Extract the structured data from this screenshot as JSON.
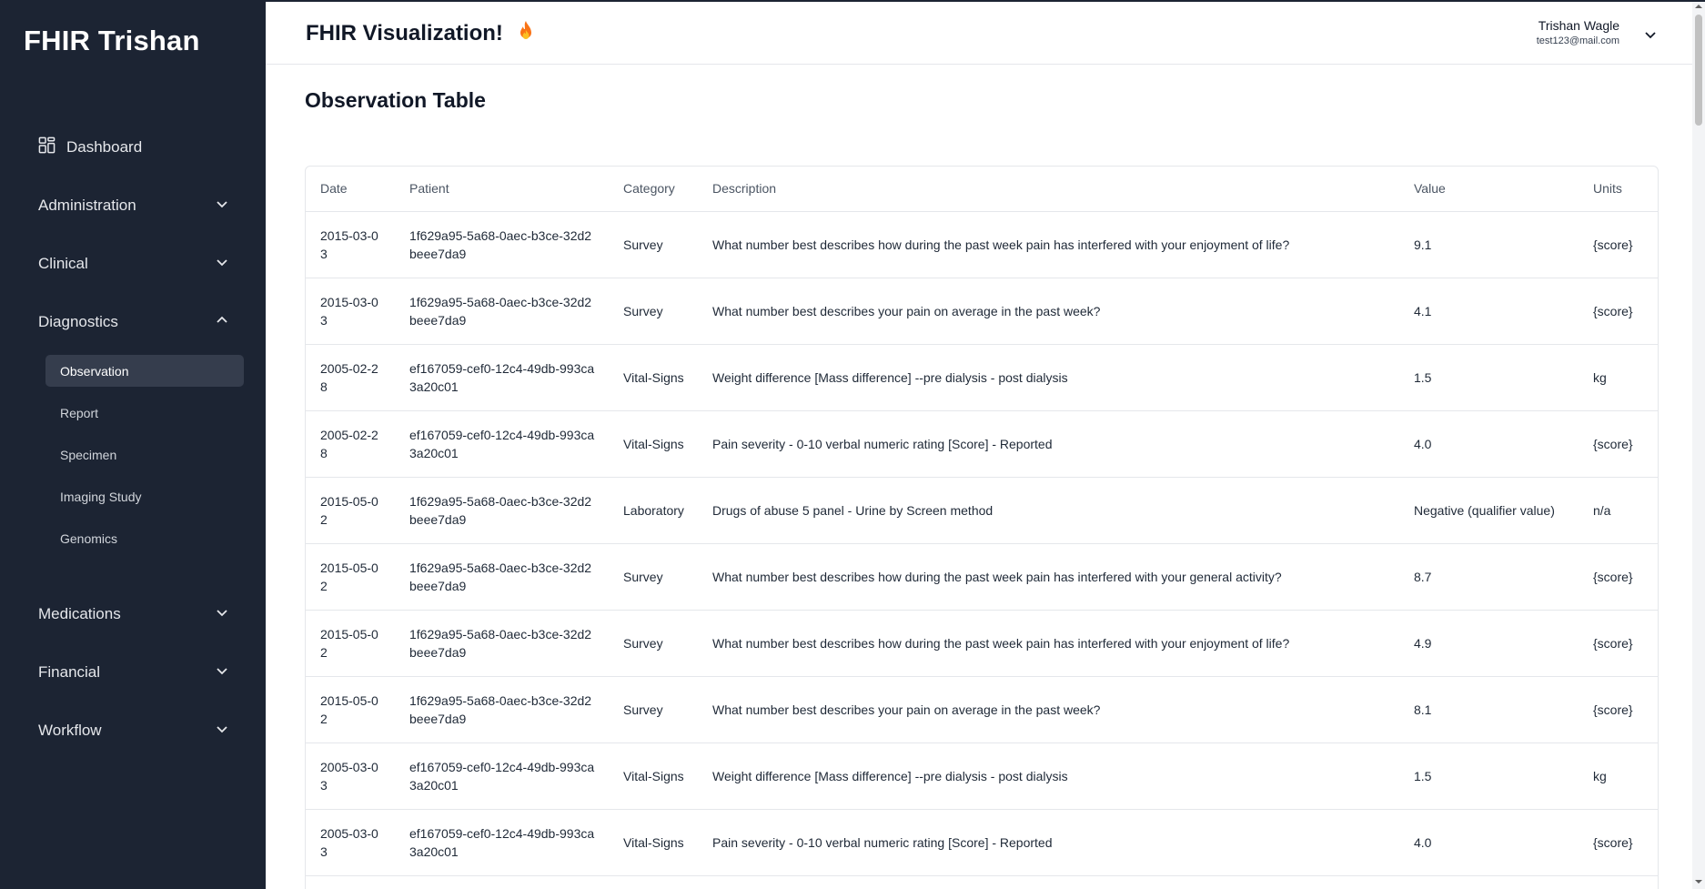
{
  "sidebar": {
    "brand": "FHIR Trishan",
    "dashboard": {
      "label": "Dashboard",
      "icon": "dashboard-grid-icon"
    },
    "groups": {
      "administration": {
        "label": "Administration",
        "expanded": false
      },
      "clinical": {
        "label": "Clinical",
        "expanded": false
      },
      "diagnostics": {
        "label": "Diagnostics",
        "expanded": true,
        "items": [
          "Observation",
          "Report",
          "Specimen",
          "Imaging Study",
          "Genomics"
        ],
        "active": "Observation"
      },
      "medications": {
        "label": "Medications",
        "expanded": false
      },
      "financial": {
        "label": "Financial",
        "expanded": false
      },
      "workflow": {
        "label": "Workflow",
        "expanded": false
      }
    }
  },
  "header": {
    "title": "FHIR Visualization!",
    "title_icon": "fire-icon",
    "user": {
      "name": "Trishan Wagle",
      "email": "test123@mail.com"
    }
  },
  "main": {
    "page_title": "Observation Table",
    "table": {
      "headers": [
        "Date",
        "Patient",
        "Category",
        "Description",
        "Value",
        "Units"
      ],
      "rows": [
        [
          "2015-03-03",
          "1f629a95-5a68-0aec-b3ce-32d2beee7da9",
          "Survey",
          "What number best describes how during the past week pain has interfered with your enjoyment of life?",
          "9.1",
          "{score}"
        ],
        [
          "2015-03-03",
          "1f629a95-5a68-0aec-b3ce-32d2beee7da9",
          "Survey",
          "What number best describes your pain on average in the past week?",
          "4.1",
          "{score}"
        ],
        [
          "2005-02-28",
          "ef167059-cef0-12c4-49db-993ca3a20c01",
          "Vital-Signs",
          "Weight difference [Mass difference] --pre dialysis - post dialysis",
          "1.5",
          "kg"
        ],
        [
          "2005-02-28",
          "ef167059-cef0-12c4-49db-993ca3a20c01",
          "Vital-Signs",
          "Pain severity - 0-10 verbal numeric rating [Score] - Reported",
          "4.0",
          "{score}"
        ],
        [
          "2015-05-02",
          "1f629a95-5a68-0aec-b3ce-32d2beee7da9",
          "Laboratory",
          "Drugs of abuse 5 panel - Urine by Screen method",
          "Negative (qualifier value)",
          "n/a"
        ],
        [
          "2015-05-02",
          "1f629a95-5a68-0aec-b3ce-32d2beee7da9",
          "Survey",
          "What number best describes how during the past week pain has interfered with your general activity?",
          "8.7",
          "{score}"
        ],
        [
          "2015-05-02",
          "1f629a95-5a68-0aec-b3ce-32d2beee7da9",
          "Survey",
          "What number best describes how during the past week pain has interfered with your enjoyment of life?",
          "4.9",
          "{score}"
        ],
        [
          "2015-05-02",
          "1f629a95-5a68-0aec-b3ce-32d2beee7da9",
          "Survey",
          "What number best describes your pain on average in the past week?",
          "8.1",
          "{score}"
        ],
        [
          "2005-03-03",
          "ef167059-cef0-12c4-49db-993ca3a20c01",
          "Vital-Signs",
          "Weight difference [Mass difference] --pre dialysis - post dialysis",
          "1.5",
          "kg"
        ],
        [
          "2005-03-03",
          "ef167059-cef0-12c4-49db-993ca3a20c01",
          "Vital-Signs",
          "Pain severity - 0-10 verbal numeric rating [Score] - Reported",
          "4.0",
          "{score}"
        ]
      ]
    }
  }
}
